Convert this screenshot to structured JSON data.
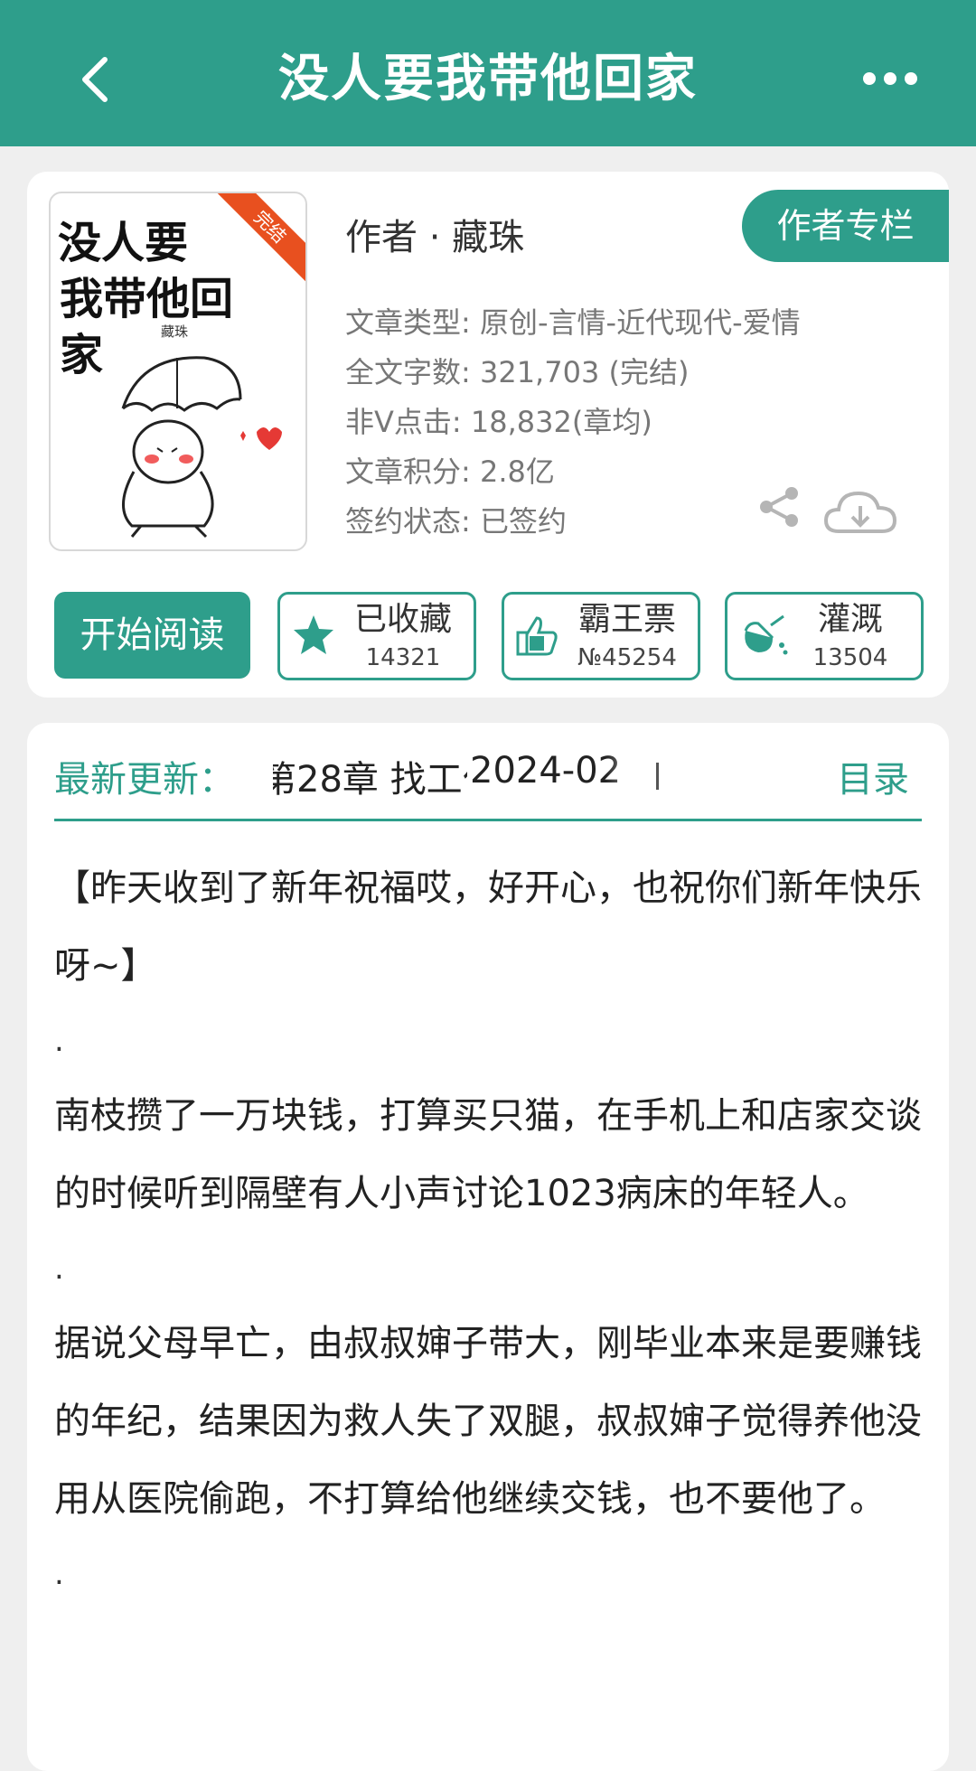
{
  "header": {
    "title": "没人要我带他回家"
  },
  "book": {
    "cover": {
      "title_line1": "没人要",
      "title_line2": "我带他回家",
      "author_small": "藏珠",
      "ribbon": "完结"
    },
    "author_line": "作者 · 藏珠",
    "author_column_label": "作者专栏",
    "meta": [
      {
        "label": "文章类型:",
        "value": "原创-言情-近代现代-爱情"
      },
      {
        "label": "全文字数:",
        "value": "321,703 (完结)"
      },
      {
        "label": "非Ⅴ点击:",
        "value": "18,832(章均)"
      },
      {
        "label": "文章积分:",
        "value": "2.8亿"
      },
      {
        "label": "签约状态:",
        "value": "已签约"
      }
    ]
  },
  "actions": {
    "read_label": "开始阅读",
    "buttons": [
      {
        "label": "已收藏",
        "count": "14321",
        "icon": "star-icon"
      },
      {
        "label": "霸王票",
        "count": "№45254",
        "icon": "thumbs-up-icon"
      },
      {
        "label": "灌溉",
        "count": "13504",
        "icon": "watering-icon"
      }
    ]
  },
  "latest": {
    "label": "最新更新：",
    "chapter": "第28章  找工作啦",
    "date": "2024-02",
    "toc_label": "目录"
  },
  "content": {
    "paragraphs": [
      "【昨天收到了新年祝福哎，好开心，也祝你们新年快乐呀~】",
      ".",
      "南枝攒了一万块钱，打算买只猫，在手机上和店家交谈的时候听到隔壁有人小声讨论1023病床的年轻人。",
      ".",
      "据说父母早亡，由叔叔婶子带大，刚毕业本来是要赚钱的年纪，结果因为救人失了双腿，叔叔婶子觉得养他没用从医院偷跑，不打算给他继续交钱，也不要他了。",
      "."
    ]
  },
  "colors": {
    "accent": "#2e9e8b",
    "ribbon": "#e8501f"
  }
}
